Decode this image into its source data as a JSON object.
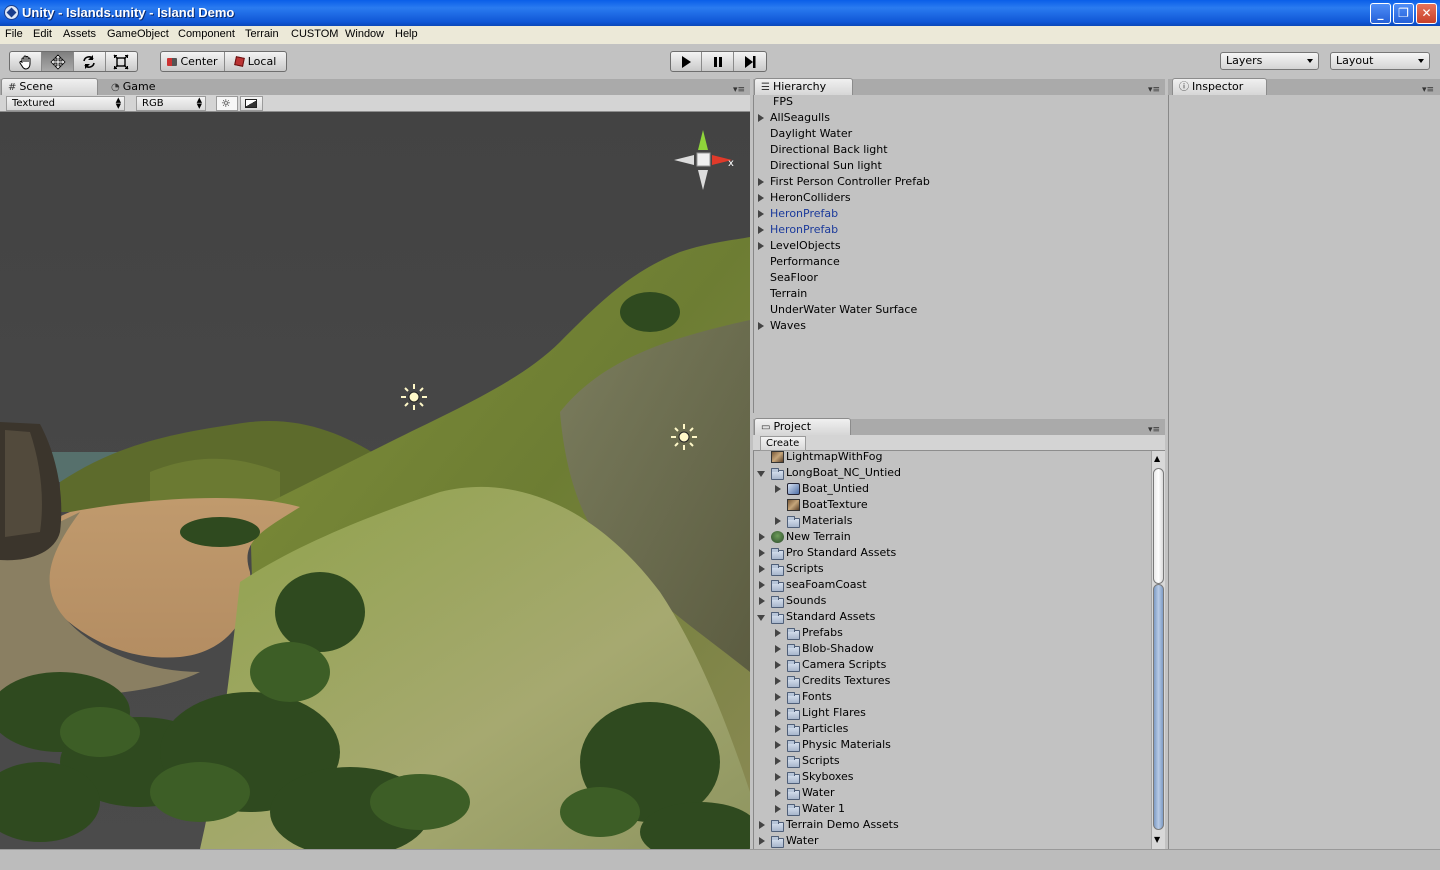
{
  "window": {
    "title": "Unity - Islands.unity - Island Demo",
    "controls": [
      "minimize",
      "maximize",
      "close"
    ]
  },
  "menu": [
    "File",
    "Edit",
    "Assets",
    "GameObject",
    "Component",
    "Terrain",
    "CUSTOM",
    "Window",
    "Help"
  ],
  "toolbar": {
    "transform_tools": [
      "hand-icon",
      "move-icon",
      "rotate-icon",
      "scale-icon"
    ],
    "active_tool": "move-icon",
    "pivot_label": "Center",
    "space_label": "Local",
    "playback": [
      "play-icon",
      "pause-icon",
      "step-icon"
    ],
    "layers_label": "Layers",
    "layout_label": "Layout"
  },
  "scene": {
    "tabs": [
      {
        "label": "Scene",
        "icon": "grid-icon",
        "active": true
      },
      {
        "label": "Game",
        "icon": "pacman-icon",
        "active": false
      }
    ],
    "draw_mode": "Textured",
    "render_mode": "RGB",
    "toggles": [
      "sun-icon",
      "image-icon"
    ],
    "gizmo_axis_label": "x"
  },
  "hierarchy": {
    "title": "Hierarchy",
    "items": [
      {
        "label": "FPS",
        "expandable": false,
        "prefab": false
      },
      {
        "label": "AllSeagulls",
        "expandable": true,
        "prefab": false
      },
      {
        "label": "Daylight Water",
        "expandable": false,
        "prefab": false
      },
      {
        "label": "Directional Back light",
        "expandable": false,
        "prefab": false
      },
      {
        "label": "Directional Sun light",
        "expandable": false,
        "prefab": false
      },
      {
        "label": "First Person Controller Prefab",
        "expandable": true,
        "prefab": false
      },
      {
        "label": "HeronColliders",
        "expandable": true,
        "prefab": false
      },
      {
        "label": "HeronPrefab",
        "expandable": true,
        "prefab": true
      },
      {
        "label": "HeronPrefab",
        "expandable": true,
        "prefab": true
      },
      {
        "label": "LevelObjects",
        "expandable": true,
        "prefab": false
      },
      {
        "label": "Performance",
        "expandable": false,
        "prefab": false
      },
      {
        "label": "SeaFloor",
        "expandable": false,
        "prefab": false
      },
      {
        "label": "Terrain",
        "expandable": false,
        "prefab": false
      },
      {
        "label": "UnderWater Water Surface",
        "expandable": false,
        "prefab": false
      },
      {
        "label": "Waves",
        "expandable": true,
        "prefab": false
      }
    ]
  },
  "project": {
    "title": "Project",
    "create_label": "Create",
    "items": [
      {
        "label": "LightmapWithFog",
        "depth": 0,
        "toggle": "none",
        "icon": "texture-icon"
      },
      {
        "label": "LongBoat_NC_Untied",
        "depth": 0,
        "toggle": "open",
        "icon": "folder-icon"
      },
      {
        "label": "Boat_Untied",
        "depth": 1,
        "toggle": "closed",
        "icon": "model-icon"
      },
      {
        "label": "BoatTexture",
        "depth": 1,
        "toggle": "none",
        "icon": "texture-icon"
      },
      {
        "label": "Materials",
        "depth": 1,
        "toggle": "closed",
        "icon": "folder-icon"
      },
      {
        "label": "New Terrain",
        "depth": 0,
        "toggle": "closed",
        "icon": "terrain-icon"
      },
      {
        "label": "Pro Standard Assets",
        "depth": 0,
        "toggle": "closed",
        "icon": "folder-icon"
      },
      {
        "label": "Scripts",
        "depth": 0,
        "toggle": "closed",
        "icon": "folder-icon"
      },
      {
        "label": "seaFoamCoast",
        "depth": 0,
        "toggle": "closed",
        "icon": "folder-icon"
      },
      {
        "label": "Sounds",
        "depth": 0,
        "toggle": "closed",
        "icon": "folder-icon"
      },
      {
        "label": "Standard Assets",
        "depth": 0,
        "toggle": "open",
        "icon": "folder-icon"
      },
      {
        "label": " Prefabs",
        "depth": 1,
        "toggle": "closed",
        "icon": "folder-icon"
      },
      {
        "label": "Blob-Shadow",
        "depth": 1,
        "toggle": "closed",
        "icon": "folder-icon"
      },
      {
        "label": "Camera Scripts",
        "depth": 1,
        "toggle": "closed",
        "icon": "folder-icon"
      },
      {
        "label": "Credits Textures",
        "depth": 1,
        "toggle": "closed",
        "icon": "folder-icon"
      },
      {
        "label": "Fonts",
        "depth": 1,
        "toggle": "closed",
        "icon": "folder-icon"
      },
      {
        "label": "Light Flares",
        "depth": 1,
        "toggle": "closed",
        "icon": "folder-icon"
      },
      {
        "label": "Particles",
        "depth": 1,
        "toggle": "closed",
        "icon": "folder-icon"
      },
      {
        "label": "Physic Materials",
        "depth": 1,
        "toggle": "closed",
        "icon": "folder-icon"
      },
      {
        "label": "Scripts",
        "depth": 1,
        "toggle": "closed",
        "icon": "folder-icon"
      },
      {
        "label": "Skyboxes",
        "depth": 1,
        "toggle": "closed",
        "icon": "folder-icon"
      },
      {
        "label": "Water",
        "depth": 1,
        "toggle": "closed",
        "icon": "folder-icon"
      },
      {
        "label": "Water 1",
        "depth": 1,
        "toggle": "closed",
        "icon": "folder-icon"
      },
      {
        "label": "Terrain Demo Assets",
        "depth": 0,
        "toggle": "closed",
        "icon": "folder-icon"
      },
      {
        "label": "Water",
        "depth": 0,
        "toggle": "closed",
        "icon": "folder-icon"
      }
    ]
  },
  "inspector": {
    "title": "Inspector"
  },
  "colors": {
    "titlebar": "#0b5de6",
    "panel_bg": "#c2c2c2",
    "prefab_text": "#1b3a9b",
    "sky": "#454545"
  }
}
